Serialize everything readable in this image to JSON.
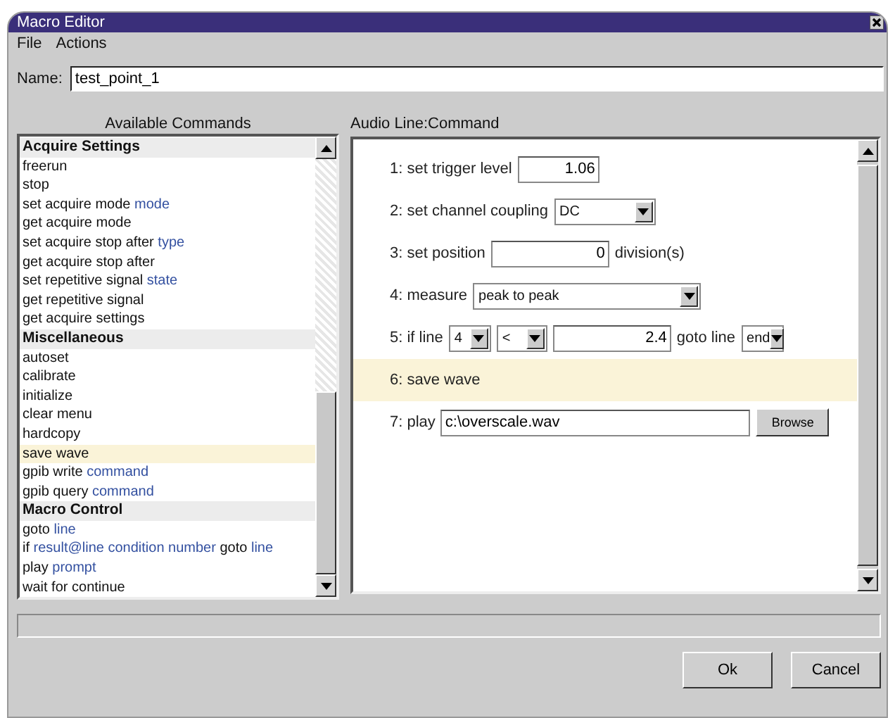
{
  "window": {
    "title": "Macro Editor"
  },
  "menu": [
    {
      "label": "File"
    },
    {
      "label": "Actions"
    }
  ],
  "name_field": {
    "label": "Name:",
    "value": "test_point_1"
  },
  "commands_panel": {
    "heading": "Available Commands",
    "items": [
      {
        "kind": "header",
        "selected": false,
        "parts": [
          {
            "text": "Acquire Settings",
            "param": false
          }
        ]
      },
      {
        "kind": "item",
        "selected": false,
        "parts": [
          {
            "text": "freerun",
            "param": false
          }
        ]
      },
      {
        "kind": "item",
        "selected": false,
        "parts": [
          {
            "text": "stop",
            "param": false
          }
        ]
      },
      {
        "kind": "item",
        "selected": false,
        "parts": [
          {
            "text": "set acquire mode",
            "param": false
          },
          {
            "text": "mode",
            "param": true
          }
        ]
      },
      {
        "kind": "item",
        "selected": false,
        "parts": [
          {
            "text": "get acquire mode",
            "param": false
          }
        ]
      },
      {
        "kind": "item",
        "selected": false,
        "parts": [
          {
            "text": "set acquire stop after",
            "param": false
          },
          {
            "text": "type",
            "param": true
          }
        ]
      },
      {
        "kind": "item",
        "selected": false,
        "parts": [
          {
            "text": "get acquire stop after",
            "param": false
          }
        ]
      },
      {
        "kind": "item",
        "selected": false,
        "parts": [
          {
            "text": "set repetitive signal",
            "param": false
          },
          {
            "text": "state",
            "param": true
          }
        ]
      },
      {
        "kind": "item",
        "selected": false,
        "parts": [
          {
            "text": "get repetitive signal",
            "param": false
          }
        ]
      },
      {
        "kind": "item",
        "selected": false,
        "parts": [
          {
            "text": "get acquire settings",
            "param": false
          }
        ]
      },
      {
        "kind": "header",
        "selected": false,
        "parts": [
          {
            "text": "Miscellaneous",
            "param": false
          }
        ]
      },
      {
        "kind": "item",
        "selected": false,
        "parts": [
          {
            "text": "autoset",
            "param": false
          }
        ]
      },
      {
        "kind": "item",
        "selected": false,
        "parts": [
          {
            "text": "calibrate",
            "param": false
          }
        ]
      },
      {
        "kind": "item",
        "selected": false,
        "parts": [
          {
            "text": "initialize",
            "param": false
          }
        ]
      },
      {
        "kind": "item",
        "selected": false,
        "parts": [
          {
            "text": "clear menu",
            "param": false
          }
        ]
      },
      {
        "kind": "item",
        "selected": false,
        "parts": [
          {
            "text": "hardcopy",
            "param": false
          }
        ]
      },
      {
        "kind": "item",
        "selected": true,
        "parts": [
          {
            "text": "save wave",
            "param": false
          }
        ]
      },
      {
        "kind": "item",
        "selected": false,
        "parts": [
          {
            "text": "gpib write",
            "param": false
          },
          {
            "text": "command",
            "param": true
          }
        ]
      },
      {
        "kind": "item",
        "selected": false,
        "parts": [
          {
            "text": "gpib query",
            "param": false
          },
          {
            "text": "command",
            "param": true
          }
        ]
      },
      {
        "kind": "header",
        "selected": false,
        "parts": [
          {
            "text": "Macro Control",
            "param": false
          }
        ]
      },
      {
        "kind": "item",
        "selected": false,
        "parts": [
          {
            "text": "goto",
            "param": false
          },
          {
            "text": "line",
            "param": true
          }
        ]
      },
      {
        "kind": "item",
        "selected": false,
        "parts": [
          {
            "text": "if",
            "param": false
          },
          {
            "text": "result@line",
            "param": true
          },
          {
            "text": "condition",
            "param": true
          },
          {
            "text": "number",
            "param": true
          },
          {
            "text": "goto",
            "param": false
          },
          {
            "text": "line",
            "param": true
          }
        ]
      },
      {
        "kind": "item",
        "selected": false,
        "parts": [
          {
            "text": "play",
            "param": false
          },
          {
            "text": "prompt",
            "param": true
          }
        ]
      },
      {
        "kind": "item",
        "selected": false,
        "parts": [
          {
            "text": "wait for continue",
            "param": false
          }
        ]
      }
    ]
  },
  "macro_panel": {
    "heading": "Audio Line:Command",
    "lines": [
      {
        "selected": false,
        "parts": [
          {
            "kind": "label",
            "text": "1: set trigger level"
          },
          {
            "kind": "input",
            "value": "1.06"
          }
        ]
      },
      {
        "selected": false,
        "parts": [
          {
            "kind": "label",
            "text": "2: set channel coupling"
          },
          {
            "kind": "select",
            "value": "DC"
          }
        ]
      },
      {
        "selected": false,
        "parts": [
          {
            "kind": "label",
            "text": "3: set position"
          },
          {
            "kind": "input",
            "value": "0"
          },
          {
            "kind": "label",
            "text": "division(s)"
          }
        ]
      },
      {
        "selected": false,
        "parts": [
          {
            "kind": "label",
            "text": "4: measure"
          },
          {
            "kind": "select",
            "value": "peak to peak"
          }
        ]
      },
      {
        "selected": false,
        "parts": [
          {
            "kind": "label",
            "text": "5: if line"
          },
          {
            "kind": "select",
            "value": "4"
          },
          {
            "kind": "select",
            "value": "<"
          },
          {
            "kind": "input",
            "value": "2.4"
          },
          {
            "kind": "label",
            "text": "goto line"
          },
          {
            "kind": "select",
            "value": "end"
          }
        ]
      },
      {
        "selected": true,
        "parts": [
          {
            "kind": "label",
            "text": "6: save wave"
          }
        ]
      },
      {
        "selected": false,
        "parts": [
          {
            "kind": "label",
            "text": "7: play"
          },
          {
            "kind": "input",
            "value": "c:\\overscale.wav"
          },
          {
            "kind": "button",
            "text": "Browse"
          }
        ]
      }
    ]
  },
  "buttons": [
    {
      "label": "Ok"
    },
    {
      "label": "Cancel"
    }
  ]
}
